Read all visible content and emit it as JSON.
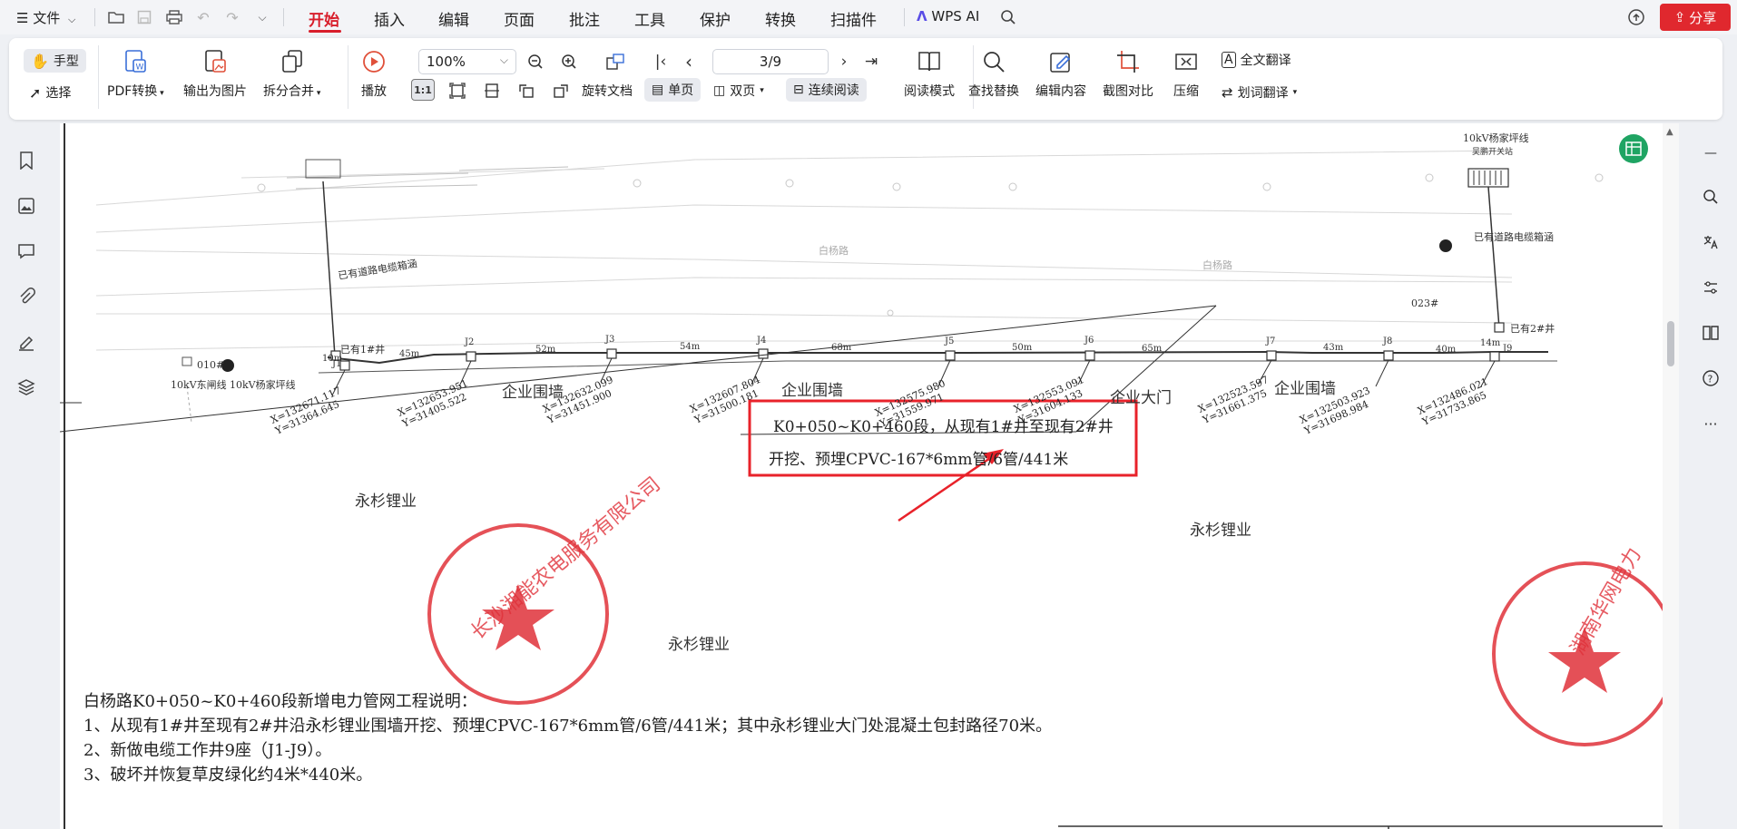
{
  "menubar": {
    "file_label": "文件",
    "tabs": [
      "开始",
      "插入",
      "编辑",
      "页面",
      "批注",
      "工具",
      "保护",
      "转换",
      "扫描件"
    ],
    "wps_ai": "WPS AI",
    "share": "分享"
  },
  "ribbon": {
    "hand": "手型",
    "select": "选择",
    "pdf_convert": "PDF转换",
    "export_image": "输出为图片",
    "split_merge": "拆分合并",
    "play": "播放",
    "zoom_value": "100%",
    "page_value": "3/9",
    "rotate_doc": "旋转文档",
    "single_page": "单页",
    "double_page": "双页",
    "continuous": "连续阅读",
    "read_mode": "阅读模式",
    "find_replace": "查找替换",
    "edit_content": "编辑内容",
    "screenshot_compare": "截图对比",
    "compress": "压缩",
    "full_translate": "全文翻译",
    "word_translate": "划词翻译",
    "ratio_label": "1:1"
  },
  "drawing": {
    "top_right_line": "10kV杨家坪线",
    "top_right_station": "吴鹏开关站",
    "existing_box_left": "已有道路电缆箱涵",
    "existing_box_right": "已有道路电缆箱涵",
    "road_left": "白杨路",
    "road_right": "白杨路",
    "well_023": "023#",
    "well_010": "010#",
    "existing_well_1": "已有1#井",
    "existing_well_2": "已有2#井",
    "line_dongzha": "10kV东闸线",
    "line_yangjiaping": "10kV杨家坪线",
    "j_labels": [
      "J1",
      "J2",
      "J3",
      "J4",
      "J5",
      "J6",
      "J7",
      "J8",
      "J9"
    ],
    "distances": [
      "10m",
      "45m",
      "52m",
      "54m",
      "68m",
      "50m",
      "65m",
      "43m",
      "40m",
      "14m"
    ],
    "coordinates": [
      {
        "x": "X=132671.117",
        "y": "Y=31364.645"
      },
      {
        "x": "X=132653.951",
        "y": "Y=31405.522"
      },
      {
        "x": "X=132632.099",
        "y": "Y=31451.900"
      },
      {
        "x": "X=132607.804",
        "y": "Y=31500.181"
      },
      {
        "x": "X=132575.980",
        "y": "Y=31559.971"
      },
      {
        "x": "X=132553.091",
        "y": "Y=31604.133"
      },
      {
        "x": "X=132523.597",
        "y": "Y=31661.375"
      },
      {
        "x": "X=132503.923",
        "y": "Y=31698.984"
      },
      {
        "x": "X=132486.021",
        "y": "Y=31733.865"
      }
    ],
    "wall_1": "企业围墙",
    "wall_2": "企业围墙",
    "gate": "企业大门",
    "wall_3": "企业围墙",
    "company_1": "永杉锂业",
    "company_2": "永杉锂业",
    "company_3": "永杉锂业",
    "callout_line1": "K0+050~K0+460段，从现有1#井至现有2#井",
    "callout_line2": "开挖、预埋CPVC-167*6mm管/6管/441米",
    "stamp_left_text": "长沙湘能农电服务有限公司",
    "stamp_right_text": "湖南华网电力"
  },
  "notes": {
    "title": "白杨路K0+050~K0+460段新增电力管网工程说明：",
    "items": [
      "1、从现有1#井至现有2#井沿永杉锂业围墙开挖、预埋CPVC-167*6mm管/6管/441米；其中永杉锂业大门处混凝土包封路径70米。",
      "2、新做电缆工作井9座（J1-J9）。",
      "3、破坏并恢复草皮绿化约4米*440米。"
    ]
  },
  "colors": {
    "accent": "#d81e2b",
    "callout": "#e8222a",
    "stamp": "#e0323a",
    "share_bg": "#e0282e"
  }
}
